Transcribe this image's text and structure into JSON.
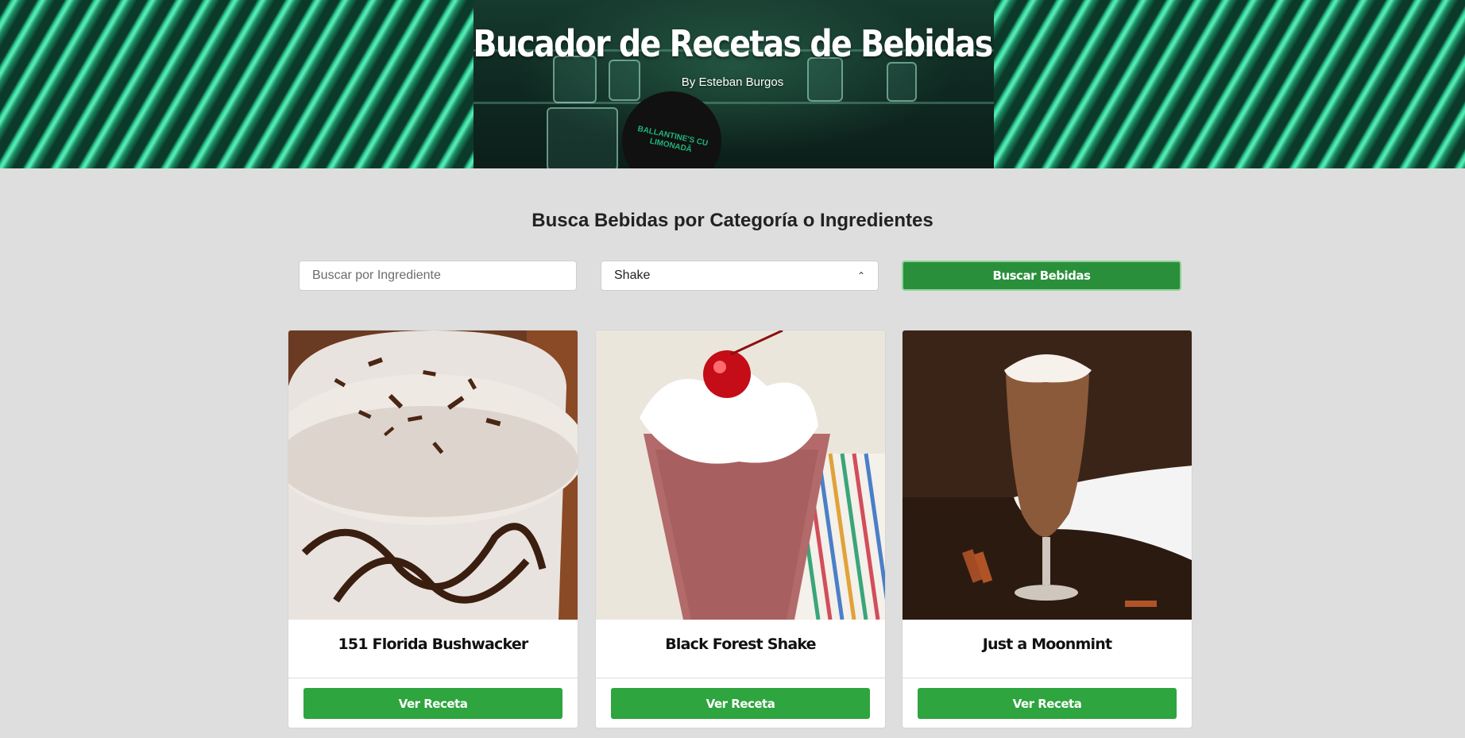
{
  "header": {
    "title": "Bucador de Recetas de Bebidas",
    "subtitle": "By Esteban Burgos",
    "background_image_label": "BALLANTINE'S CU LIMONADĂ"
  },
  "search": {
    "heading": "Busca Bebidas por Categoría o Ingredientes",
    "ingredient_placeholder": "Buscar por Ingrediente",
    "ingredient_value": "",
    "category_selected": "Shake",
    "button_label": "Buscar Bebidas"
  },
  "colors": {
    "button_green": "#2ea53e",
    "search_button_green": "#2a8f3a",
    "page_background": "#dedede"
  },
  "drinks": [
    {
      "name": "151 Florida Bushwacker",
      "button_label": "Ver Receta",
      "image": "chocolate-milkshake-photo"
    },
    {
      "name": "Black Forest Shake",
      "button_label": "Ver Receta",
      "image": "cherry-shake-photo"
    },
    {
      "name": "Just a Moonmint",
      "button_label": "Ver Receta",
      "image": "moonmint-glass-photo"
    }
  ]
}
